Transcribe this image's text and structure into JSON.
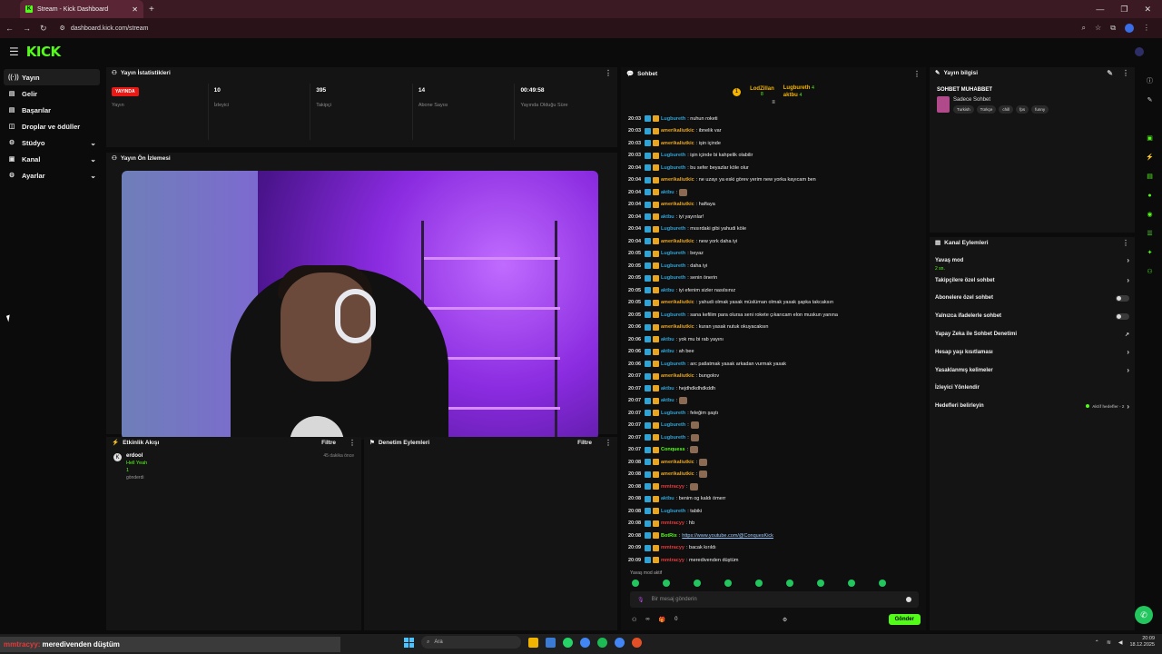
{
  "browser": {
    "tab_title": "Stream - Kick Dashboard",
    "url": "dashboard.kick.com/stream"
  },
  "app": {
    "logo": "KICK"
  },
  "sidebar": {
    "items": [
      {
        "label": "Yayın",
        "icon": "broadcast-icon",
        "active": true
      },
      {
        "label": "Gelir",
        "icon": "income-icon"
      },
      {
        "label": "Başarılar",
        "icon": "achievements-icon"
      },
      {
        "label": "Droplar ve ödüller",
        "icon": "gift-icon"
      },
      {
        "label": "Stüdyo",
        "icon": "studio-icon",
        "expandable": true
      },
      {
        "label": "Kanal",
        "icon": "channel-icon",
        "expandable": true
      },
      {
        "label": "Ayarlar",
        "icon": "settings-icon",
        "expandable": true
      }
    ]
  },
  "stats": {
    "title": "Yayın İstatistikleri",
    "live_badge": "YAYINDA",
    "items": [
      {
        "value": "",
        "label": "Yayın"
      },
      {
        "value": "10",
        "label": "İzleyici"
      },
      {
        "value": "395",
        "label": "Takipçi"
      },
      {
        "value": "14",
        "label": "Abone Sayısı"
      },
      {
        "value": "00:49:58",
        "label": "Yayında Olduğu Süre"
      }
    ]
  },
  "preview": {
    "title": "Yayın Ön İzlemesi"
  },
  "activity": {
    "title": "Etkinlik Akışı",
    "filter": "Filtre",
    "items": [
      {
        "name": "erdool",
        "message": "Hell Yeah",
        "count": "1",
        "sub": "gönderdi",
        "time": "45 dakika önce"
      }
    ]
  },
  "moderation": {
    "title": "Denetim Eylemleri",
    "filter": "Filtre"
  },
  "chat": {
    "title": "Sohbet",
    "pinned": [
      {
        "name": "LodZillan",
        "count": "8"
      },
      {
        "name": "Lugbureth",
        "count": "4"
      },
      {
        "name": "aktbu",
        "count": "4"
      }
    ],
    "messages": [
      {
        "time": "20:03",
        "user": "Lugbureth",
        "color": "#2fa3d6",
        "text": ": nuhun roketi"
      },
      {
        "time": "20:03",
        "user": "amerikaliutkic",
        "color": "#e7a521",
        "text": ": ibnelik var"
      },
      {
        "time": "20:03",
        "user": "amerikaliutkic",
        "color": "#e7a521",
        "text": ": işin içinde"
      },
      {
        "time": "20:03",
        "user": "Lugbureth",
        "color": "#2fa3d6",
        "text": ": işin içinde bi kahpelik olabilir"
      },
      {
        "time": "20:04",
        "user": "Lugbureth",
        "color": "#2fa3d6",
        "text": ": bu sefer beyazlar köle olur"
      },
      {
        "time": "20:04",
        "user": "amerikaliutkic",
        "color": "#e7a521",
        "text": ": ne uzayı ya eski görev yerim new yorka kayıcam ben"
      },
      {
        "time": "20:04",
        "user": "aktbu",
        "color": "#2fa3d6",
        "text": ":"
      },
      {
        "time": "20:04",
        "user": "amerikaliutkic",
        "color": "#e7a521",
        "text": ": haftaya"
      },
      {
        "time": "20:04",
        "user": "aktbu",
        "color": "#2fa3d6",
        "text": ": iyi yayınlar!"
      },
      {
        "time": "20:04",
        "user": "Lugbureth",
        "color": "#2fa3d6",
        "text": ": mısırdaki gibi yahudi köle"
      },
      {
        "time": "20:04",
        "user": "amerikaliutkic",
        "color": "#e7a521",
        "text": ": new york daha iyi"
      },
      {
        "time": "20:05",
        "user": "Lugbureth",
        "color": "#2fa3d6",
        "text": ": beyaz"
      },
      {
        "time": "20:05",
        "user": "Lugbureth",
        "color": "#2fa3d6",
        "text": ": daha iyi"
      },
      {
        "time": "20:05",
        "user": "Lugbureth",
        "color": "#2fa3d6",
        "text": ": senin önerin"
      },
      {
        "time": "20:05",
        "user": "aktbu",
        "color": "#2fa3d6",
        "text": ": iyi efenim sizler nasılsınız"
      },
      {
        "time": "20:05",
        "user": "amerikaliutkic",
        "color": "#e7a521",
        "text": ": yahudi olmak yasak müslüman olmak yasak şapka takcaksın"
      },
      {
        "time": "20:05",
        "user": "Lugbureth",
        "color": "#2fa3d6",
        "text": ": sana kefilim para olursa seni rokete çıkarıcam elon muskun yanına"
      },
      {
        "time": "20:06",
        "user": "amerikaliutkic",
        "color": "#e7a521",
        "text": ": kuran yasak nutuk okuyacaksın"
      },
      {
        "time": "20:06",
        "user": "aktbu",
        "color": "#2fa3d6",
        "text": ": yok mu bi rab yayını"
      },
      {
        "time": "20:06",
        "user": "aktbu",
        "color": "#2fa3d6",
        "text": ": ah bee"
      },
      {
        "time": "20:06",
        "user": "Lugbureth",
        "color": "#2fa3d6",
        "text": ": arc patlatmak yasak arkadan vurmak yasak"
      },
      {
        "time": "20:07",
        "user": "amerikaliutkic",
        "color": "#e7a521",
        "text": ": bungolov"
      },
      {
        "time": "20:07",
        "user": "aktbu",
        "color": "#2fa3d6",
        "text": ": hejdhdkdhdkddh"
      },
      {
        "time": "20:07",
        "user": "aktbu",
        "color": "#2fa3d6",
        "text": ":"
      },
      {
        "time": "20:07",
        "user": "Lugbureth",
        "color": "#2fa3d6",
        "text": ": feleğim şaştı"
      },
      {
        "time": "20:07",
        "user": "Lugbureth",
        "color": "#2fa3d6",
        "text": ":"
      },
      {
        "time": "20:07",
        "user": "Lugbureth",
        "color": "#2fa3d6",
        "text": ":"
      },
      {
        "time": "20:07",
        "user": "Conquess",
        "color": "#53fc18",
        "text": ":"
      },
      {
        "time": "20:08",
        "user": "amerikaliutkic",
        "color": "#e7a521",
        "text": ":"
      },
      {
        "time": "20:08",
        "user": "amerikaliutkic",
        "color": "#e7a521",
        "text": ":"
      },
      {
        "time": "20:08",
        "user": "mmtracyy",
        "color": "#e23b3b",
        "text": ":"
      },
      {
        "time": "20:08",
        "user": "aktbu",
        "color": "#2fa3d6",
        "text": ": benim og kaldı ömerr"
      },
      {
        "time": "20:08",
        "user": "Lugbureth",
        "color": "#2fa3d6",
        "text": ": tabiki"
      },
      {
        "time": "20:08",
        "user": "mmtracyy",
        "color": "#e23b3b",
        "text": ": hb"
      },
      {
        "time": "20:08",
        "user": "BotRix",
        "color": "#53fc18",
        "text": ": ",
        "link": "https://www.youtube.com/@ConquesKick"
      },
      {
        "time": "20:09",
        "user": "mmtracyy",
        "color": "#e23b3b",
        "text": ": bacak kırıldı"
      },
      {
        "time": "20:09",
        "user": "mmtracyy",
        "color": "#e23b3b",
        "text": ": meredivenden düştüm"
      }
    ],
    "slow_mode_notice": "Yavaş mod aktif",
    "input_placeholder": "Bir mesaj gönderin",
    "footer_count1": "∞",
    "footer_count2": "0",
    "send_label": "Gönder"
  },
  "info": {
    "title": "Yayın bilgisi",
    "stream_title": "SOHBET MUHABBET",
    "category": "Sadece Sohbet",
    "tags": [
      "Turkish",
      "Türkçe",
      "chill",
      "fps",
      "funny"
    ]
  },
  "channel_actions": {
    "title": "Kanal Eylemleri",
    "slow_mode": {
      "label": "Yavaş mod",
      "value": "2 sn."
    },
    "items": [
      {
        "label": "Takipçilere özel sohbet",
        "control": "chevron"
      },
      {
        "label": "Abonelere özel sohbet",
        "control": "toggle"
      },
      {
        "label": "Yalnızca ifadelerle sohbet",
        "control": "toggle"
      },
      {
        "label": "Yapay Zeka ile Sohbet Denetimi",
        "control": "external"
      },
      {
        "label": "Hesap yaşı kısıtlaması",
        "control": "chevron"
      },
      {
        "label": "Yasaklanmış kelimeler",
        "control": "chevron"
      },
      {
        "label": "İzleyici Yönlendir",
        "control": "none"
      }
    ],
    "goals": {
      "label": "Hedefleri belirleyin",
      "status": "Aktif hedefler - 2"
    }
  },
  "overlay": {
    "user": "mmtracyy:",
    "text": "meredivenden düştüm"
  },
  "taskbar": {
    "search": "Ara",
    "time": "20:09",
    "date": "18.12.2025"
  }
}
